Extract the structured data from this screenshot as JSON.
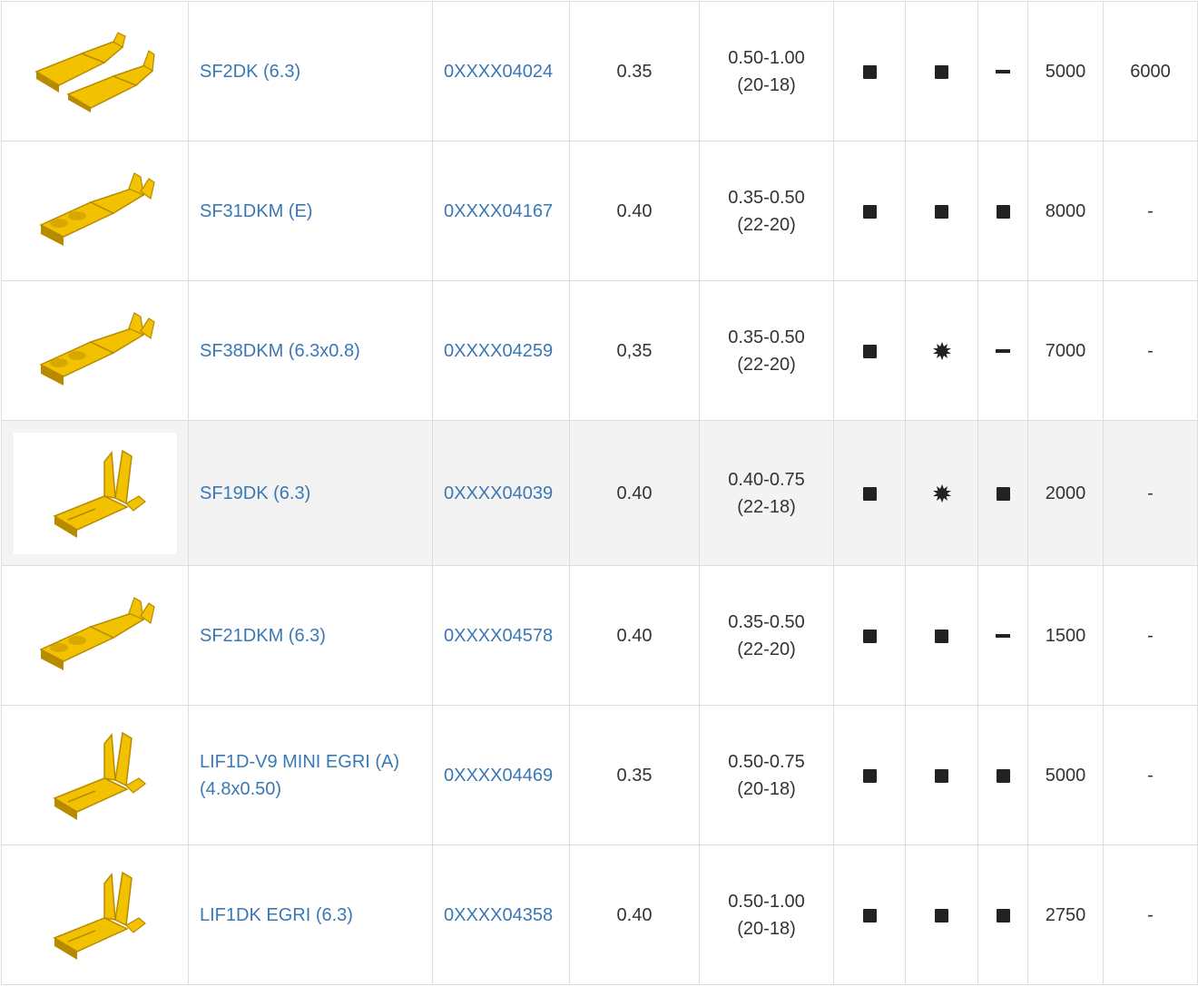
{
  "colors": {
    "link": "#3a78b5",
    "terminal_fill": "#f2c200",
    "terminal_edge": "#b88a00",
    "symbol": "#222222",
    "border": "#dddddd",
    "highlight": "#f3f3f3"
  },
  "rows": [
    {
      "image": "terminal-double-icon",
      "name": "SF2DK (6.3)",
      "code": "0XXXX04024",
      "thickness": "0.35",
      "range_top": "0.50-1.00",
      "range_bottom": "(20-18)",
      "s1": "square",
      "s2": "square",
      "s3": "dash",
      "qty1": "5000",
      "qty2": "6000",
      "highlight": false
    },
    {
      "image": "terminal-icon",
      "name": "SF31DKM (E)",
      "code": "0XXXX04167",
      "thickness": "0.40",
      "range_top": "0.35-0.50",
      "range_bottom": "(22-20)",
      "s1": "square",
      "s2": "square",
      "s3": "square",
      "qty1": "8000",
      "qty2": "-",
      "highlight": false
    },
    {
      "image": "terminal-icon",
      "name": "SF38DKM (6.3x0.8)",
      "code": "0XXXX04259",
      "thickness": "0,35",
      "range_top": "0.35-0.50",
      "range_bottom": "(22-20)",
      "s1": "square",
      "s2": "star",
      "s3": "dash",
      "qty1": "7000",
      "qty2": "-",
      "highlight": false
    },
    {
      "image": "terminal-flag-icon",
      "name": "SF19DK (6.3)",
      "code": "0XXXX04039",
      "thickness": "0.40",
      "range_top": "0.40-0.75",
      "range_bottom": "(22-18)",
      "s1": "square",
      "s2": "star",
      "s3": "square",
      "qty1": "2000",
      "qty2": "-",
      "highlight": true
    },
    {
      "image": "terminal-icon",
      "name": "SF21DKM (6.3)",
      "code": "0XXXX04578",
      "thickness": "0.40",
      "range_top": "0.35-0.50",
      "range_bottom": "(22-20)",
      "s1": "square",
      "s2": "square",
      "s3": "dash",
      "qty1": "1500",
      "qty2": "-",
      "highlight": false
    },
    {
      "image": "terminal-flag-icon",
      "name": "LIF1D-V9 MINI EGRI (A) (4.8x0.50)",
      "code": "0XXXX04469",
      "thickness": "0.35",
      "range_top": "0.50-0.75",
      "range_bottom": "(20-18)",
      "s1": "square",
      "s2": "square",
      "s3": "square",
      "qty1": "5000",
      "qty2": "-",
      "highlight": false
    },
    {
      "image": "terminal-flag-icon",
      "name": "LIF1DK EGRI (6.3)",
      "code": "0XXXX04358",
      "thickness": "0.40",
      "range_top": "0.50-1.00",
      "range_bottom": "(20-18)",
      "s1": "square",
      "s2": "square",
      "s3": "square",
      "qty1": "2750",
      "qty2": "-",
      "highlight": false
    }
  ]
}
